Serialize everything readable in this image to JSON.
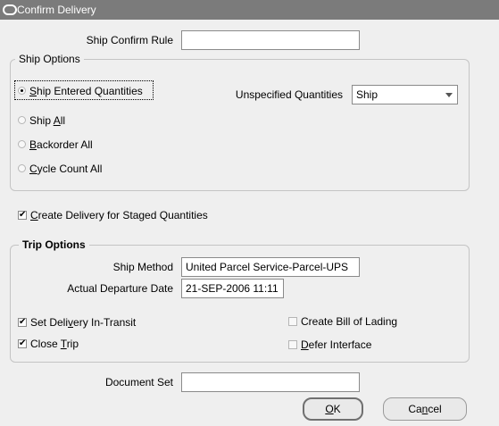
{
  "window": {
    "title": "Confirm Delivery"
  },
  "ship_confirm_rule": {
    "label": "Ship Confirm Rule",
    "value": ""
  },
  "ship_options": {
    "legend": "Ship Options",
    "radios": [
      {
        "pre": "",
        "mn": "S",
        "post": "hip Entered Quantities",
        "selected": true
      },
      {
        "pre": "Ship ",
        "mn": "A",
        "post": "ll",
        "selected": false
      },
      {
        "pre": "",
        "mn": "B",
        "post": "ackorder All",
        "selected": false
      },
      {
        "pre": "",
        "mn": "C",
        "post": "ycle Count All",
        "selected": false
      }
    ],
    "unspecified_label": "Unspecified Quantities",
    "unspecified_value": "Ship"
  },
  "create_delivery": {
    "pre": "",
    "mn": "C",
    "post": "reate Delivery for Staged Quantities",
    "checked": true
  },
  "trip_options": {
    "legend": "Trip Options",
    "ship_method_label": "Ship Method",
    "ship_method_value": "United Parcel Service-Parcel-UPS",
    "departure_label": "Actual Departure Date",
    "departure_value": "21-SEP-2006 11:11",
    "set_in_transit": {
      "pre": "Set Deli",
      "mn": "v",
      "post": "ery In-Transit",
      "checked": true
    },
    "close_trip": {
      "pre": "Close ",
      "mn": "T",
      "post": "rip",
      "checked": true
    },
    "create_bol": {
      "pre": "Create Bill of Lading",
      "mn": "",
      "post": "",
      "checked": false
    },
    "defer_interface": {
      "pre": "",
      "mn": "D",
      "post": "efer Interface",
      "checked": false
    }
  },
  "document_set": {
    "label": "Document Set",
    "value": ""
  },
  "buttons": {
    "ok": {
      "mn": "O",
      "post": "K"
    },
    "cancel": {
      "pre": "Ca",
      "mn": "n",
      "post": "cel"
    }
  },
  "colors": {
    "titlebar": "#7b7b7b",
    "background": "#efefef",
    "group_border": "#c4c4c4"
  }
}
